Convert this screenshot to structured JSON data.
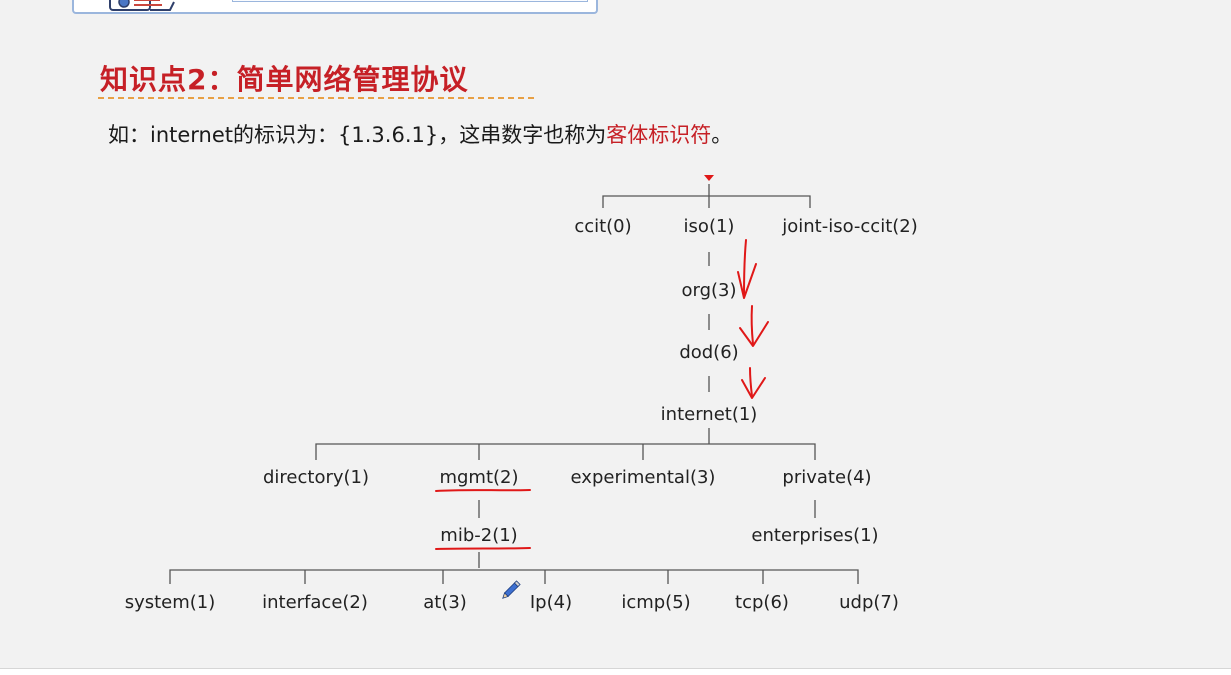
{
  "slide": {
    "title": "知识点2：简单网络管理协议",
    "intro": {
      "before": "如：internet的标识为：{1.3.6.1}，这串数字也称为",
      "highlight": "客体标识符",
      "after": "。"
    }
  },
  "tree": {
    "level1": [
      "ccit(0)",
      "iso(1)",
      "joint-iso-ccit(2)"
    ],
    "chain": [
      "org(3)",
      "dod(6)",
      "internet(1)"
    ],
    "internet_children": [
      "directory(1)",
      "mgmt(2)",
      "experimental(3)",
      "private(4)"
    ],
    "mib": "mib-2(1)",
    "enterprises": "enterprises(1)",
    "mib_children": [
      "system(1)",
      "interface(2)",
      "at(3)",
      "Ip(4)",
      "icmp(5)",
      "tcp(6)",
      "udp(7)"
    ]
  },
  "colors": {
    "accent_red": "#c62026",
    "ink_red": "#e01818",
    "title_underline": "#e8a044",
    "slide_bg": "#f2f2f2"
  },
  "icons": [
    "mascot-illustration",
    "pencil-cursor-icon"
  ]
}
